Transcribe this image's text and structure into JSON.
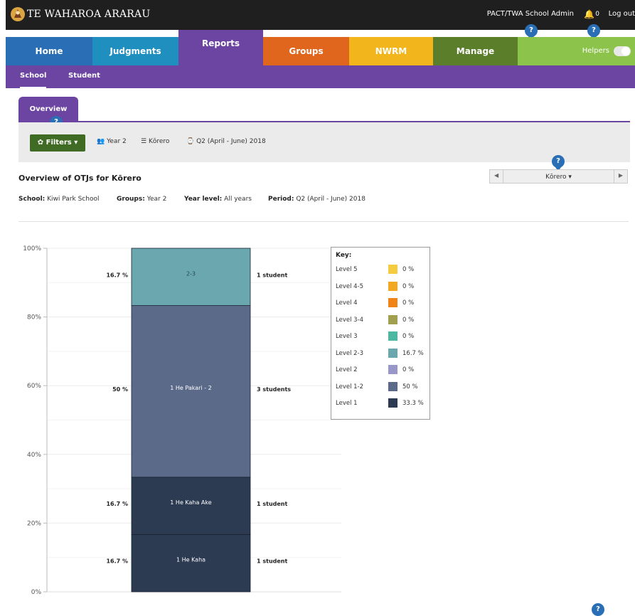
{
  "header": {
    "app_title": "TE WAHAROA ARARAU",
    "user": "PACT/TWA School Admin",
    "notifications": "0",
    "logout": "Log out",
    "help_symbol": "?"
  },
  "nav": {
    "items": [
      {
        "label": "Home",
        "color": "#2a6fb5"
      },
      {
        "label": "Judgments",
        "color": "#1f8fc0"
      },
      {
        "label": "Reports",
        "color": "#6b45a1"
      },
      {
        "label": "Groups",
        "color": "#e0661e"
      },
      {
        "label": "NWRM",
        "color": "#f2b51c"
      },
      {
        "label": "Manage",
        "color": "#5b7e2b"
      }
    ],
    "helpers_label": "Helpers",
    "helpers_color": "#8cc34a"
  },
  "subnav": {
    "items": [
      "School",
      "Student"
    ],
    "active": "School"
  },
  "tabs": {
    "overview": "Overview"
  },
  "filters": {
    "button_label": "Filters",
    "year": "Year 2",
    "subject": "Kōrero",
    "period": "Q2 (April - June) 2018"
  },
  "report": {
    "title": "Overview of OTJs for Kōrero",
    "subject_select": "Kōrero",
    "school_label": "School:",
    "school": "Kiwi Park School",
    "groups_label": "Groups:",
    "groups": "Year 2",
    "year_level_label": "Year level:",
    "year_level": "All years",
    "period_label": "Period:",
    "period": "Q2 (April - June) 2018"
  },
  "chart_data": {
    "type": "bar",
    "stacked": true,
    "y_ticks": [
      "0%",
      "20%",
      "40%",
      "60%",
      "80%",
      "100%"
    ],
    "ylim": [
      0,
      100
    ],
    "segments": [
      {
        "level": "Level 1",
        "label": "1 He Kaha",
        "percent": 16.7,
        "percent_label": "16.7 %",
        "students": "1 student",
        "color": "#2c3a52",
        "text_color": "#ffffff"
      },
      {
        "level": "Level 1",
        "label": "1 He Kaha Ake",
        "percent": 16.7,
        "percent_label": "16.7 %",
        "students": "1 student",
        "color": "#2c3a52",
        "text_color": "#ffffff"
      },
      {
        "level": "Level 1-2",
        "label": "1 He Pakari - 2",
        "percent": 50,
        "percent_label": "50 %",
        "students": "3 students",
        "color": "#5c6a8a",
        "text_color": "#ffffff"
      },
      {
        "level": "Level 2-3",
        "label": "2-3",
        "percent": 16.7,
        "percent_label": "16.7 %",
        "students": "1 student",
        "color": "#6aa7af",
        "text_color": "#2a4a50"
      }
    ],
    "key": {
      "title": "Key:",
      "items": [
        {
          "label": "Level 5",
          "value": "0 %",
          "color": "#f5cc3f"
        },
        {
          "label": "Level 4-5",
          "value": "0 %",
          "color": "#f2a823"
        },
        {
          "label": "Level 4",
          "value": "0 %",
          "color": "#f08418"
        },
        {
          "label": "Level 3-4",
          "value": "0 %",
          "color": "#a1a04e"
        },
        {
          "label": "Level 3",
          "value": "0 %",
          "color": "#4db8a1"
        },
        {
          "label": "Level 2-3",
          "value": "16.7 %",
          "color": "#6aa7af"
        },
        {
          "label": "Level 2",
          "value": "0 %",
          "color": "#9997c8"
        },
        {
          "label": "Level 1-2",
          "value": "50 %",
          "color": "#5c6a8a"
        },
        {
          "label": "Level 1",
          "value": "33.3 %",
          "color": "#2c3a52"
        }
      ]
    }
  }
}
